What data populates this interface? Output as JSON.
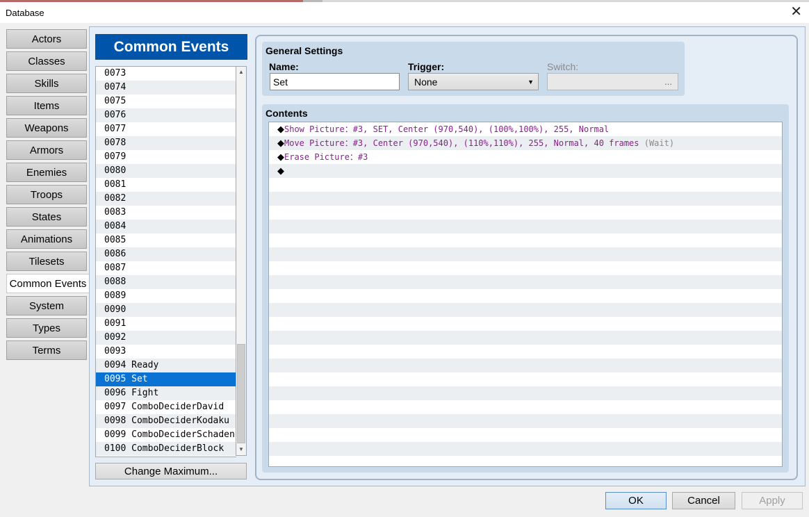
{
  "window": {
    "title": "Database"
  },
  "tabs": [
    "Actors",
    "Classes",
    "Skills",
    "Items",
    "Weapons",
    "Armors",
    "Enemies",
    "Troops",
    "States",
    "Animations",
    "Tilesets",
    "Common Events",
    "System",
    "Types",
    "Terms"
  ],
  "active_tab": "Common Events",
  "panel_title": "Common Events",
  "events": [
    "0073",
    "0074",
    "0075",
    "0076",
    "0077",
    "0078",
    "0079",
    "0080",
    "0081",
    "0082",
    "0083",
    "0084",
    "0085",
    "0086",
    "0087",
    "0088",
    "0089",
    "0090",
    "0091",
    "0092",
    "0093",
    "0094 Ready",
    "0095 Set",
    "0096 Fight",
    "0097 ComboDeciderDavid",
    "0098 ComboDeciderKodaku",
    "0099 ComboDeciderSchaden",
    "0100 ComboDeciderBlock"
  ],
  "selected_event": "0095 Set",
  "change_max_label": "Change Maximum...",
  "general": {
    "title": "General Settings",
    "name_label": "Name:",
    "name_value": "Set",
    "trigger_label": "Trigger:",
    "trigger_value": "None",
    "switch_label": "Switch:",
    "switch_button": "..."
  },
  "contents": {
    "title": "Contents",
    "commands": [
      {
        "text": "Show Picture：#3, SET, Center (970,540), (100%,100%), 255, Normal",
        "wait": ""
      },
      {
        "text": "Move Picture：#3, Center (970,540), (110%,110%), 255, Normal, 40 frames",
        "wait": "(Wait)"
      },
      {
        "text": "Erase Picture：#3",
        "wait": ""
      },
      {
        "text": "",
        "wait": ""
      }
    ],
    "total_rows": 24
  },
  "buttons": {
    "ok": "OK",
    "cancel": "Cancel",
    "apply": "Apply"
  }
}
